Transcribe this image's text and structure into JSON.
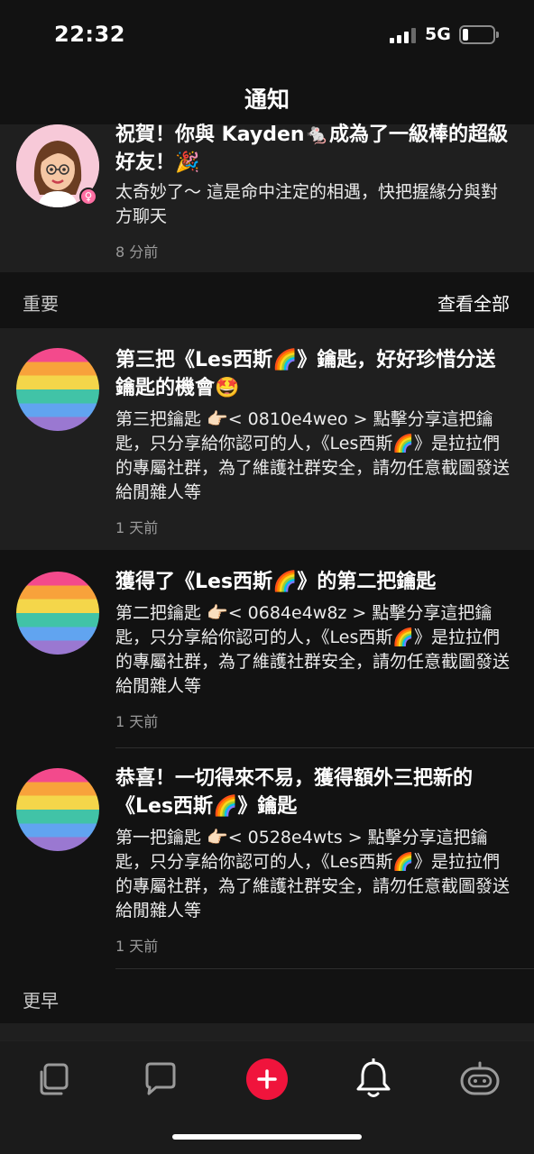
{
  "status_bar": {
    "time": "22:32",
    "network": "5G"
  },
  "nav": {
    "title": "通知"
  },
  "top_notification": {
    "title": "祝賀！你與 Kayden🐁成為了一級棒的超級好友！🎉",
    "body": "太奇妙了～ 這是命中注定的相遇，快把握緣分與對方聊天",
    "time": "8 分前"
  },
  "section_important": {
    "label": "重要",
    "link": "查看全部"
  },
  "notifications": [
    {
      "title": "第三把《Les西斯🌈》鑰匙，好好珍惜分送鑰匙的機會🤩",
      "body": "第三把鑰匙 👉🏻< 0810e4weo > 點擊分享這把鑰匙，只分享給你認可的人，《Les西斯🌈》是拉拉們的專屬社群，為了維護社群安全，請勿任意截圖發送給閒雜人等",
      "time": "1 天前"
    },
    {
      "title": "獲得了《Les西斯🌈》的第二把鑰匙",
      "body": "第二把鑰匙 👉🏻< 0684e4w8z > 點擊分享這把鑰匙，只分享給你認可的人，《Les西斯🌈》是拉拉們的專屬社群，為了維護社群安全，請勿任意截圖發送給閒雜人等",
      "time": "1 天前"
    },
    {
      "title": "恭喜！一切得來不易，獲得額外三把新的《Les西斯🌈》鑰匙",
      "body": "第一把鑰匙 👉🏻< 0528e4wts > 點擊分享這把鑰匙，只分享給你認可的人，《Les西斯🌈》是拉拉們的專屬社群，為了維護社群安全，請勿任意截圖發送給閒雜人等",
      "time": "1 天前"
    }
  ],
  "section_earlier": {
    "label": "更早"
  },
  "tabbar": {
    "items": [
      {
        "icon": "cards-icon"
      },
      {
        "icon": "chat-bubble-icon"
      },
      {
        "icon": "plus-icon",
        "accent": "#f0143c"
      },
      {
        "icon": "bell-icon"
      },
      {
        "icon": "bot-icon"
      }
    ]
  },
  "colors": {
    "background": "#121212",
    "card": "#1f1f1f",
    "accent": "#f0143c"
  }
}
